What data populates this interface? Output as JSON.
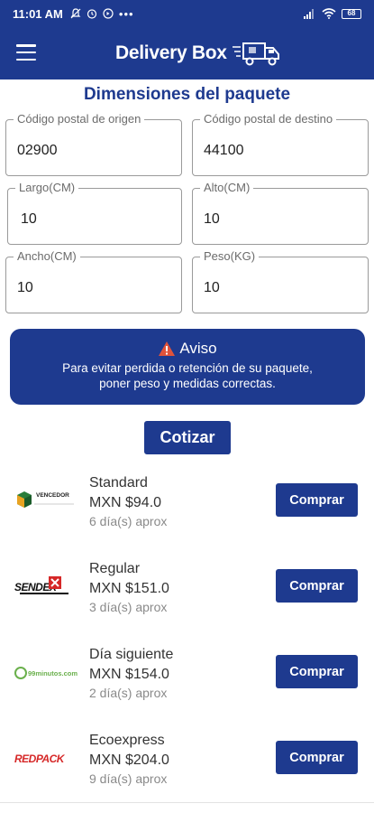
{
  "status": {
    "time": "11:01 AM",
    "battery": "68",
    "left_icons": [
      "mute-icon",
      "alarm-icon",
      "data-saver-icon",
      "more-icon"
    ],
    "right_icons": [
      "signal-icon",
      "wifi-icon",
      "battery-icon"
    ]
  },
  "appbar": {
    "brand": "Delivery Box"
  },
  "section_title": "Dimensiones del paquete",
  "fields": {
    "origen": {
      "label": "Código postal de origen",
      "value": "02900"
    },
    "destino": {
      "label": "Código postal de destino",
      "value": "44100"
    },
    "largo": {
      "label": "Largo(CM)",
      "value": "10"
    },
    "alto": {
      "label": "Alto(CM)",
      "value": "10"
    },
    "ancho": {
      "label": "Ancho(CM)",
      "value": "10"
    },
    "peso": {
      "label": "Peso(KG)",
      "value": "10"
    }
  },
  "aviso": {
    "title": "Aviso",
    "line1": "Para evitar perdida o retención de su paquete,",
    "line2": "poner peso y medidas correctas."
  },
  "cotizar": "Cotizar",
  "quotes": [
    {
      "carrier_logo": "VENCEDOR",
      "service": "Standard",
      "price": "MXN $94.0",
      "days": "6 día(s) aprox",
      "button": "Comprar"
    },
    {
      "carrier_logo": "SENDEX",
      "service": "Regular",
      "price": "MXN $151.0",
      "days": "3 día(s) aprox",
      "button": "Comprar"
    },
    {
      "carrier_logo": "99minutos.com",
      "service": "Día siguiente",
      "price": "MXN $154.0",
      "days": "2 día(s) aprox",
      "button": "Comprar"
    },
    {
      "carrier_logo": "REDPACK",
      "service": "Ecoexpress",
      "price": "MXN $204.0",
      "days": "9 día(s) aprox",
      "button": "Comprar"
    }
  ],
  "colors": {
    "primary": "#1e3a8f",
    "warning": "#e0533b"
  }
}
